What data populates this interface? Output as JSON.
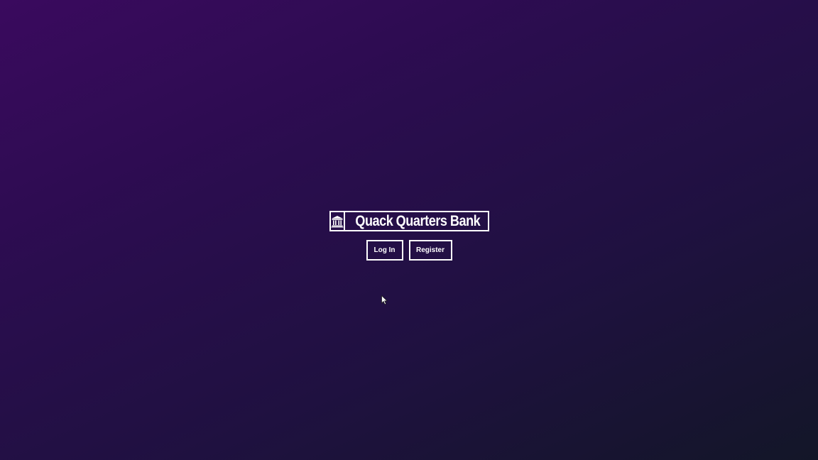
{
  "brand": {
    "words": [
      "Quack",
      "Quarters",
      "Bank"
    ],
    "logo_icon": "bank-building-icon"
  },
  "actions": {
    "login_label": "Log In",
    "register_label": "Register"
  },
  "colors": {
    "bg_top_left": "#3a0a5e",
    "bg_bottom_right": "#131628",
    "foreground": "#ffffff"
  },
  "cursor": {
    "icon": "mouse-pointer-icon"
  }
}
